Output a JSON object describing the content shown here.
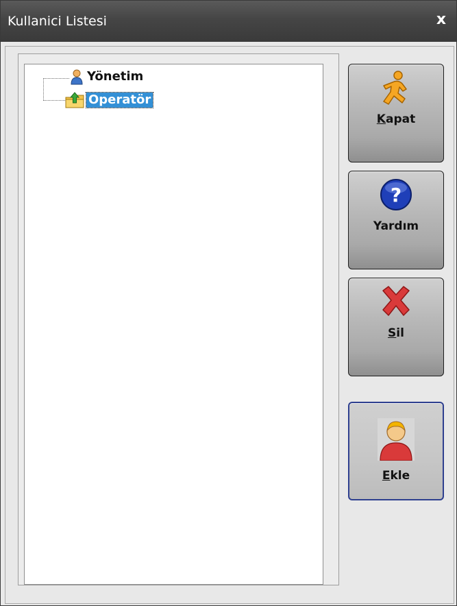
{
  "window": {
    "title": "Kullanici Listesi",
    "close_glyph": "x"
  },
  "tree": {
    "nodes": [
      {
        "label": "Yönetim",
        "icon": "user-icon",
        "selected": false
      },
      {
        "label": "Operatör",
        "icon": "folder-user-icon",
        "selected": true
      }
    ]
  },
  "buttons": {
    "kapat": {
      "accel": "K",
      "rest": "apat",
      "icon": "running-man-icon"
    },
    "yardim": {
      "accel": "",
      "rest": "Yardım",
      "icon": "help-icon"
    },
    "sil": {
      "accel": "S",
      "rest": "il",
      "icon": "delete-x-icon"
    },
    "ekle": {
      "accel": "E",
      "rest": "kle",
      "icon": "add-user-icon"
    }
  },
  "colors": {
    "selection": "#3390d6",
    "titlebar": "#454545",
    "focus_border": "#2e3f8f",
    "delete_red": "#d93a3a",
    "help_blue": "#1f3fb8"
  }
}
